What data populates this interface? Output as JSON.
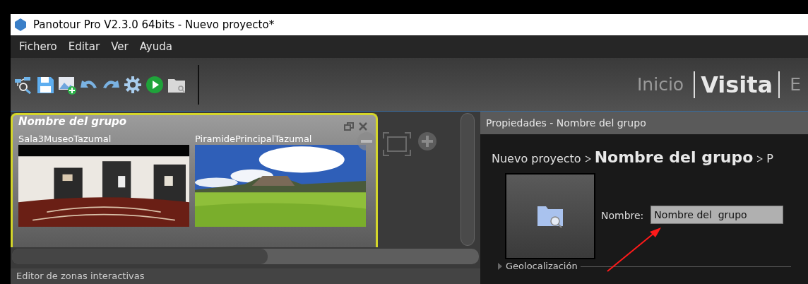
{
  "window": {
    "title": "Panotour Pro V2.3.0 64bits - Nuevo proyecto*"
  },
  "menu": [
    "Fichero",
    "Editar",
    "Ver",
    "Ayuda"
  ],
  "mode_tabs": [
    {
      "label": "Inicio",
      "selected": false
    },
    {
      "label": "Visita",
      "selected": true
    },
    {
      "label": "E",
      "selected": false
    }
  ],
  "group": {
    "title": "Nombre del  grupo",
    "selected": true,
    "panoramas": [
      {
        "name": "Sala3MuseoTazumal",
        "kind": "picture"
      },
      {
        "name": "PiramidePrincipalTazumal",
        "kind": "picture"
      }
    ]
  },
  "zone_editor": {
    "title": "Editor de zonas interactivas"
  },
  "properties": {
    "title": "Propiedades - Nombre del  grupo",
    "breadcrumb": [
      {
        "label": "Nuevo proyecto",
        "current": false
      },
      {
        "label": "Nombre del grupo",
        "current": true
      },
      {
        "label": "P",
        "current": false
      }
    ],
    "name_label": "Nombre:",
    "name_value": "Nombre del  grupo",
    "sections": [
      {
        "label": "Geolocalización",
        "expanded": false
      }
    ]
  }
}
